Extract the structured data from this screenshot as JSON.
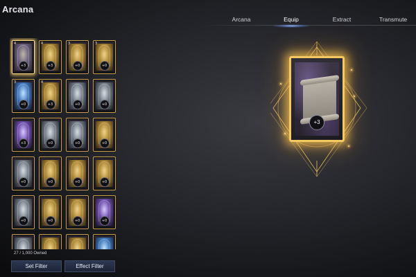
{
  "header": {
    "title": "Arcana"
  },
  "tabs": [
    {
      "label": "Arcana",
      "active": false
    },
    {
      "label": "Equip",
      "active": true
    },
    {
      "label": "Extract",
      "active": false
    },
    {
      "label": "Transmute",
      "active": false
    }
  ],
  "grid": {
    "cards": [
      {
        "cost": "4",
        "level": "+3",
        "art": "scroll",
        "selected": true
      },
      {
        "cost": "4",
        "level": "+3",
        "art": "gold",
        "selected": false
      },
      {
        "cost": "3",
        "level": "+0",
        "art": "gold",
        "selected": false
      },
      {
        "cost": "3",
        "level": "+0",
        "art": "gold",
        "selected": false
      },
      {
        "cost": "3",
        "level": "+0",
        "art": "blue",
        "selected": false
      },
      {
        "cost": "4",
        "level": "+3",
        "art": "gold",
        "selected": false
      },
      {
        "cost": "",
        "level": "+0",
        "art": "silver",
        "selected": false
      },
      {
        "cost": "",
        "level": "+0",
        "art": "silver",
        "selected": false
      },
      {
        "cost": "",
        "level": "+3",
        "art": "purple",
        "selected": false
      },
      {
        "cost": "",
        "level": "+0",
        "art": "silver",
        "selected": false
      },
      {
        "cost": "",
        "level": "+0",
        "art": "silver",
        "selected": false
      },
      {
        "cost": "",
        "level": "+0",
        "art": "gold",
        "selected": false
      },
      {
        "cost": "",
        "level": "+0",
        "art": "silver",
        "selected": false
      },
      {
        "cost": "",
        "level": "+0",
        "art": "gold",
        "selected": false
      },
      {
        "cost": "",
        "level": "+0",
        "art": "gold",
        "selected": false
      },
      {
        "cost": "",
        "level": "+0",
        "art": "gold",
        "selected": false
      },
      {
        "cost": "",
        "level": "+0",
        "art": "silver",
        "selected": false
      },
      {
        "cost": "",
        "level": "+0",
        "art": "gold",
        "selected": false
      },
      {
        "cost": "",
        "level": "+0",
        "art": "gold",
        "selected": false
      },
      {
        "cost": "",
        "level": "+0",
        "art": "purple",
        "selected": false
      },
      {
        "cost": "",
        "level": "",
        "art": "silver",
        "selected": false
      },
      {
        "cost": "",
        "level": "",
        "art": "gold",
        "selected": false
      },
      {
        "cost": "",
        "level": "",
        "art": "gold",
        "selected": false
      },
      {
        "cost": "",
        "level": "",
        "art": "blue",
        "selected": false
      }
    ]
  },
  "footer": {
    "owned": "27 / 1,000 Owned",
    "set_filter": "Set Filter",
    "effect_filter": "Effect Filter"
  },
  "featured": {
    "level": "+3",
    "art": "scroll"
  },
  "colors": {
    "gold_border": "#c9a24a",
    "gold_glow": "#f4c960",
    "tab_glow": "#96b9ff",
    "button_bg": "#2b3650"
  }
}
